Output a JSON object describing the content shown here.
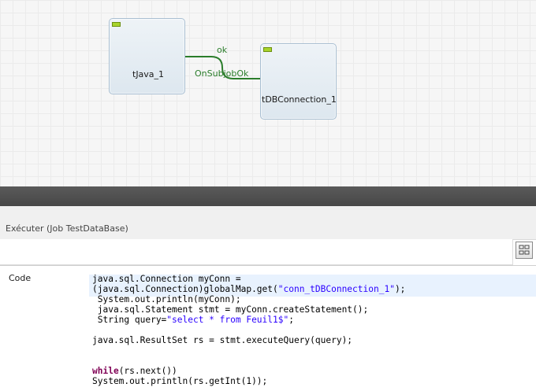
{
  "canvas": {
    "components": [
      {
        "name": "tJava_1",
        "connector_badge": "0"
      },
      {
        "name": "tDBConnection_1",
        "connector_badge": "T"
      }
    ],
    "links": [
      {
        "label": "ok",
        "color": "#2b7d2b"
      },
      {
        "label": "OnSubjobOk",
        "color": "#2b7d2b"
      }
    ]
  },
  "panel": {
    "title": "Exécuter (Job TestDataBase)",
    "code_field_label": "Code",
    "layout_button_icon": "layout-toggle-icon"
  },
  "code": {
    "line1": "java.sql.Connection myConn =",
    "line2_a": "(java.sql.Connection)globalMap.get(",
    "line2_str": "\"conn_tDBConnection_1\"",
    "line2_b": ");",
    "line3": " System.out.println(myConn);",
    "line4": " java.sql.Statement stmt = myConn.createStatement();",
    "line5_a": " String query=",
    "line5_str": "\"select * from Feuil1$\"",
    "line5_b": ";",
    "line6": "java.sql.ResultSet rs = stmt.executeQuery(query);",
    "line7_kw": "while",
    "line7_b": "(rs.next())",
    "line8": "System.out.println(rs.getInt(1));"
  },
  "colors": {
    "link": "#2b7d2b",
    "string_literal": "#2a00ff",
    "keyword": "#7f0055",
    "status_ok": "#a8d42c"
  }
}
